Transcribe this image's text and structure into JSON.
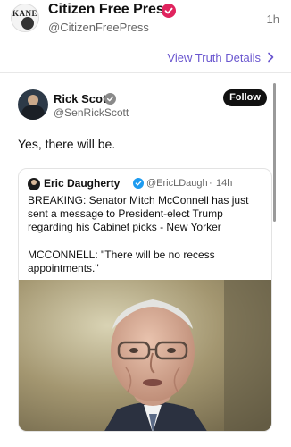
{
  "post": {
    "author_name": "Citizen Free Press",
    "author_handle": "@CitizenFreePress",
    "time": "1h",
    "avatar_text": "KANE"
  },
  "view_details": "View Truth Details",
  "embed": {
    "name": "Rick Scott",
    "handle": "@SenRickScott",
    "follow_label": "Follow",
    "text": "Yes, there will be."
  },
  "quote": {
    "name": "Eric Daugherty",
    "handle": "@EricLDaugh",
    "dot": "·",
    "time": "14h",
    "text": "BREAKING: Senator Mitch McConnell has just sent a message to President-elect Trump regarding his Cabinet picks - New Yorker",
    "text2": "MCCONNELL: \"There will be no recess appointments.\""
  },
  "colors": {
    "verified_red": "#e0245e",
    "verified_blue": "#1d9bf0",
    "link": "#6a56cf"
  }
}
